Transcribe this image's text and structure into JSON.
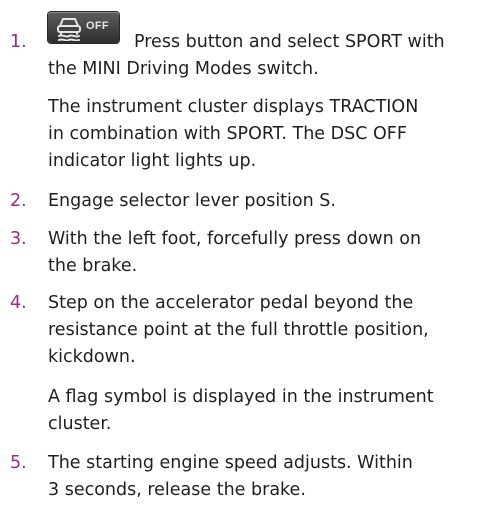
{
  "steps": [
    {
      "number": "1.",
      "icon": "dsc-off-icon",
      "icon_label": "OFF",
      "lines": [
        "Press button and select SPORT with",
        "the MINI Driving Modes switch."
      ],
      "note_lines": [
        "The instrument cluster displays TRACTION",
        "in combination with SPORT. The DSC OFF",
        "indicator light lights up."
      ]
    },
    {
      "number": "2.",
      "lines": [
        "Engage selector lever position S."
      ]
    },
    {
      "number": "3.",
      "lines": [
        "With the left foot, forcefully press down on",
        "the brake."
      ]
    },
    {
      "number": "4.",
      "lines": [
        "Step on the accelerator pedal beyond the",
        "resistance point at the full throttle position,",
        "kickdown."
      ],
      "note_lines": [
        "A flag symbol is displayed in the instrument",
        "cluster."
      ]
    },
    {
      "number": "5.",
      "lines": [
        "The starting engine speed adjusts. Within",
        "3 seconds, release the brake."
      ]
    }
  ],
  "colors": {
    "step_number": "#9c2a86",
    "body_text": "#1f1f1f"
  }
}
